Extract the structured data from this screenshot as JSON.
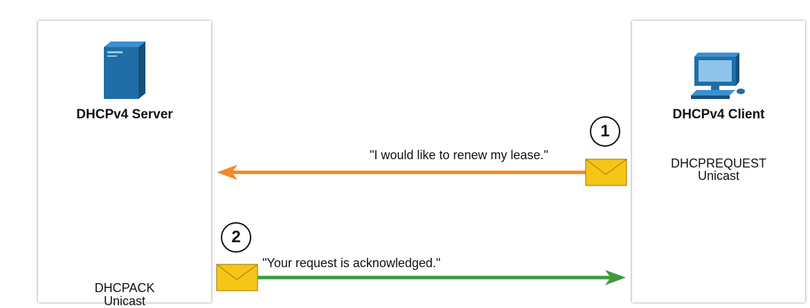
{
  "server": {
    "title": "DHCPv4 Server",
    "message_type": "DHCPACK",
    "delivery": "Unicast"
  },
  "client": {
    "title": "DHCPv4 Client",
    "message_type": "DHCPREQUEST",
    "delivery": "Unicast"
  },
  "steps": [
    {
      "number": "1",
      "text": "\"I would like to renew my lease.\""
    },
    {
      "number": "2",
      "text": "\"Your request is acknowledged.\""
    }
  ],
  "colors": {
    "request_arrow": "#f08a2c",
    "ack_arrow": "#3e9a3e",
    "device": "#1f6ea8",
    "envelope": "#f5c518"
  }
}
